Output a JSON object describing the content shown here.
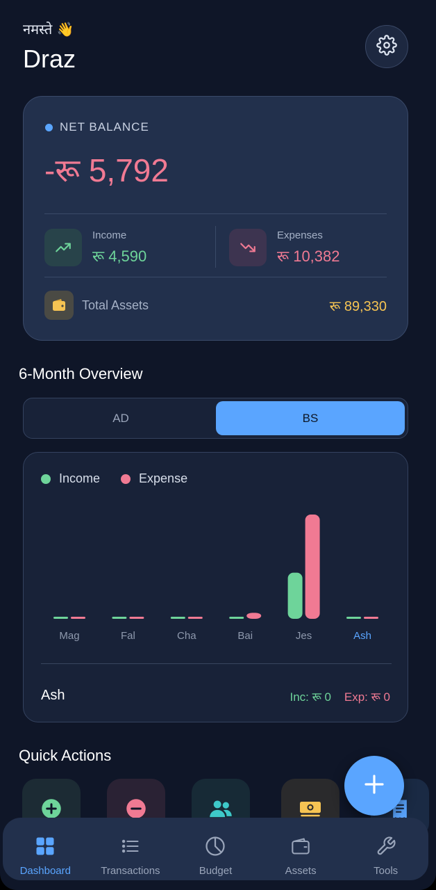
{
  "header": {
    "greeting": "नमस्ते 👋",
    "user_name": "Draz",
    "settings_icon": "gear-icon"
  },
  "balance_card": {
    "label": "NET BALANCE",
    "net_balance": "-रू 5,792",
    "income": {
      "label": "Income",
      "value": "रू 4,590",
      "icon": "trending-up-icon"
    },
    "expenses": {
      "label": "Expenses",
      "value": "रू 10,382",
      "icon": "trending-down-icon"
    },
    "total_assets": {
      "label": "Total Assets",
      "value": "रू 89,330",
      "icon": "wallet-icon"
    }
  },
  "overview": {
    "title": "6-Month Overview",
    "toggle": {
      "options": [
        "AD",
        "BS"
      ],
      "selected": "BS"
    },
    "selected_month": "Ash",
    "selected_income": "Inc: रू 0",
    "selected_expense": "Exp: रू 0"
  },
  "chart_data": {
    "type": "bar",
    "categories": [
      "Mag",
      "Fal",
      "Cha",
      "Bai",
      "Jes",
      "Ash"
    ],
    "series": [
      {
        "name": "Income",
        "values": [
          0,
          0,
          0,
          0,
          4590,
          0
        ],
        "color": "#6ed49a"
      },
      {
        "name": "Expense",
        "values": [
          0,
          0,
          0,
          600,
          10382,
          0
        ],
        "color": "#f07a93"
      }
    ],
    "legend": "top-left",
    "highlighted_category": "Ash",
    "grid": false
  },
  "quick_actions": {
    "title": "Quick Actions",
    "items": [
      {
        "icon": "add-income-icon",
        "color": "#6ed49a",
        "bg": "#1c2b34"
      },
      {
        "icon": "add-expense-icon",
        "color": "#f07a93",
        "bg": "#2a2234"
      },
      {
        "icon": "people-icon",
        "color": "#3ec9c9",
        "bg": "#172a36"
      },
      {
        "icon": "cash-icon",
        "color": "#f6c453",
        "bg": "#2a2a2c"
      },
      {
        "icon": "receipt-icon",
        "color": "#5aa5ff",
        "bg": "#1a2a44"
      }
    ],
    "fab_icon": "plus-icon"
  },
  "bottom_nav": {
    "items": [
      {
        "label": "Dashboard",
        "icon": "grid-icon",
        "active": true
      },
      {
        "label": "Transactions",
        "icon": "list-icon",
        "active": false
      },
      {
        "label": "Budget",
        "icon": "pie-chart-icon",
        "active": false
      },
      {
        "label": "Assets",
        "icon": "wallet-icon",
        "active": false
      },
      {
        "label": "Tools",
        "icon": "wrench-icon",
        "active": false
      }
    ]
  },
  "colors": {
    "accent": "#5aa5ff",
    "income": "#6ed49a",
    "expense": "#f07a93",
    "assets": "#f6c453",
    "background": "#0f1628",
    "card": "#22304c"
  }
}
